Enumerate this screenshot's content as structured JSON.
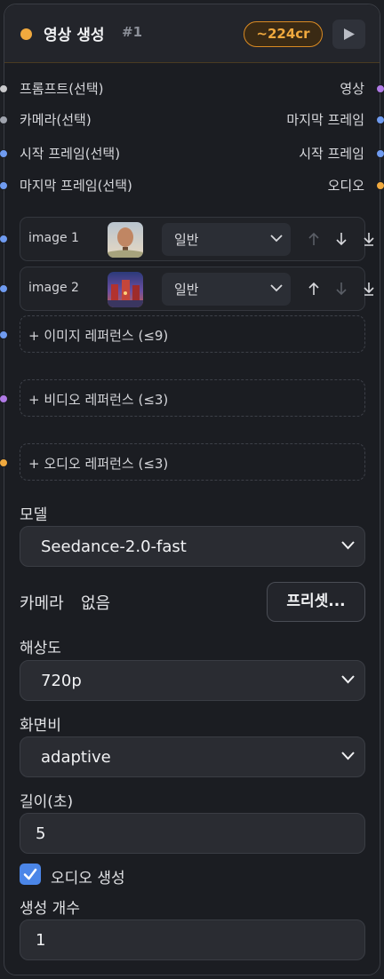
{
  "header": {
    "title": "영상 생성",
    "index": "#1",
    "cost": "~224cr",
    "accent": "#f0a93e"
  },
  "io": [
    {
      "input": "프롬프트(선택)",
      "output": "영상"
    },
    {
      "input": "카메라(선택)",
      "output": "마지막 프레임"
    },
    {
      "input": "시작 프레임(선택)",
      "output": "시작 프레임"
    },
    {
      "input": "마지막 프레임(선택)",
      "output": "오디오"
    }
  ],
  "images": [
    {
      "label": "image 1",
      "mode": "일반"
    },
    {
      "label": "image 2",
      "mode": "일반"
    }
  ],
  "refs": {
    "image": "+ 이미지 레퍼런스 (≤9)",
    "video": "+ 비디오 레퍼런스 (≤3)",
    "audio": "+ 오디오 레퍼런스 (≤3)"
  },
  "model": {
    "label": "모델",
    "value": "Seedance-2.0-fast"
  },
  "camera": {
    "label": "카메라",
    "value": "없음",
    "preset_button": "프리셋..."
  },
  "resolution": {
    "label": "해상도",
    "value": "720p"
  },
  "aspect": {
    "label": "화면비",
    "value": "adaptive"
  },
  "duration": {
    "label": "길이(초)",
    "value": "5"
  },
  "audio_gen": {
    "label": "오디오 생성",
    "checked": true
  },
  "count": {
    "label": "생성 개수",
    "value": "1"
  },
  "port_colors": {
    "text": "#c9c9cc",
    "camera": "#9fa3ad",
    "image": "#6f9bf0",
    "video": "#b07ae6",
    "audio": "#f0a93e"
  }
}
